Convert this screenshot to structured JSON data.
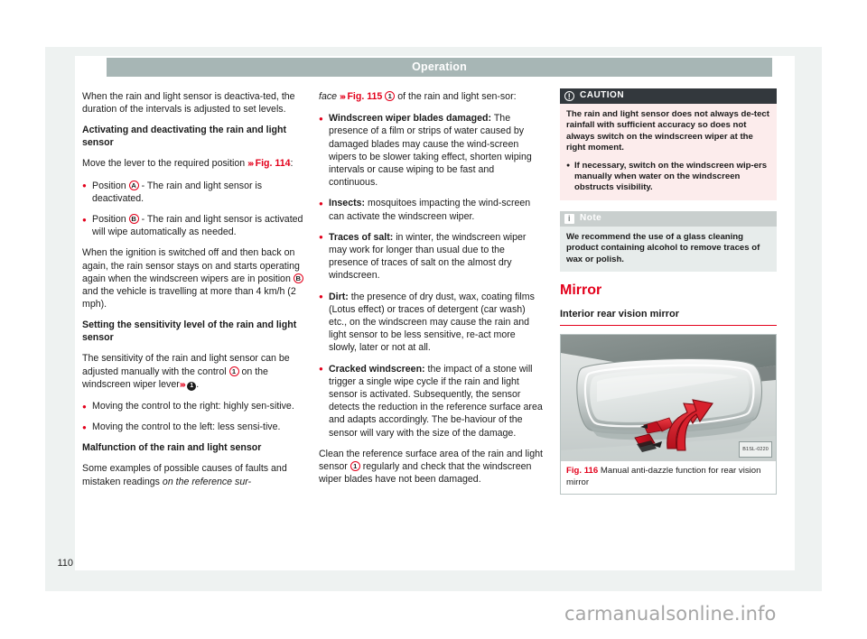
{
  "header": {
    "title": "Operation"
  },
  "folio": {
    "page_number": "110"
  },
  "column1": {
    "intro": "When the rain and light sensor is deactiva-ted, the duration of the intervals is adjusted to set levels.",
    "heading1": "Activating and deactivating the rain and light sensor",
    "para1_pre": "Move the lever to the required position",
    "para1_arrows": "›››",
    "para1_ref": "Fig. 114",
    "para1_post": ":",
    "bullet1_pre": "Position",
    "bullet1_marker": "A",
    "bullet1_post": "- The rain and light sensor is deactivated.",
    "bullet2_pre": "Position",
    "bullet2_marker": "B",
    "bullet2_post": "- The rain and light sensor is activated will wipe automatically as needed.",
    "para2_a": "When the ignition is switched off and then back on again, the rain sensor stays on and starts operating again when the windscreen wipers are in position",
    "para2_marker": "B",
    "para2_b": "and the vehicle is travelling at more than 4 km/h (2 mph).",
    "heading2": "Setting the sensitivity level of the rain and light sensor",
    "para3_a": "The sensitivity of the rain and light sensor can be adjusted manually with the control",
    "para3_marker": "1",
    "para3_b": "on the windscreen wiper lever",
    "para3_arrows": "›››",
    "para3_marker2": "1",
    "para3_c": ".",
    "bullet3": "Moving the control to the right: highly sen-sitive.",
    "bullet4": "Moving the control to the left: less sensi-tive.",
    "heading3": "Malfunction of the rain and light sensor",
    "para4_a": "Some examples of possible causes of faults and mistaken readings ",
    "para4_italic": "on the reference sur-"
  },
  "column2": {
    "cont_italic": "face",
    "cont_arrows": "›››",
    "cont_ref": "Fig. 115",
    "cont_marker": "1",
    "cont_post": "of the rain and light sen-sor:",
    "b1_label": "Windscreen wiper blades damaged:",
    "b1_text": "The presence of a film or strips of water caused by damaged blades may cause the wind-screen wipers to be slower taking effect, shorten wiping intervals or cause wiping to be fast and continuous.",
    "b2_label": "Insects:",
    "b2_text": "mosquitoes impacting the wind-screen can activate the windscreen wiper.",
    "b3_label": "Traces of salt:",
    "b3_text": "in winter, the windscreen wiper may work for longer than usual due to the presence of traces of salt on the almost dry windscreen.",
    "b4_label": "Dirt:",
    "b4_text": "the presence of dry dust, wax, coating films (Lotus effect) or traces of detergent (car wash) etc., on the windscreen may cause the rain and light sensor to be less sensitive, re-act more slowly, later or not at all.",
    "b5_label": "Cracked windscreen:",
    "b5_text": "the impact of a stone will trigger a single wipe cycle if the rain and light sensor is activated. Subsequently, the sensor detects the reduction in the reference surface area and adapts accordingly. The be-haviour of the sensor will vary with the size of the damage.",
    "final_a": "Clean the reference surface area of the rain and light sensor",
    "final_marker": "1",
    "final_b": "regularly and check that the windscreen wiper blades have not been damaged."
  },
  "caution": {
    "icon": "exclamation-icon",
    "icon_glyph": "!",
    "title": "CAUTION",
    "para1": "The rain and light sensor does not always de-tect rainfall with sufficient accuracy so does not always switch on the windscreen wiper at the right moment.",
    "bullet1": "If necessary, switch on the windscreen wip-ers manually when water on the windscreen obstructs visibility."
  },
  "note": {
    "icon": "info-icon",
    "icon_glyph": "i",
    "title": "Note",
    "para1": "We recommend the use of a glass cleaning product containing alcohol to remove traces of wax or polish."
  },
  "mirror": {
    "section_title": "Mirror",
    "subsection_title": "Interior rear vision mirror",
    "figure_code": "B1SL-0220",
    "figure_number": "Fig. 116",
    "figure_caption": "Manual anti-dazzle function for rear vision mirror"
  },
  "watermark": {
    "text": "carmanualsonline.info"
  },
  "colors": {
    "accent_red": "#e3001b",
    "header_bar": "#a7b6b5",
    "caution_head": "#33383d",
    "caution_body": "#fcecec",
    "note_head": "#c9cfce",
    "note_body": "#e7eceb",
    "page_panel": "#eef2f1"
  }
}
